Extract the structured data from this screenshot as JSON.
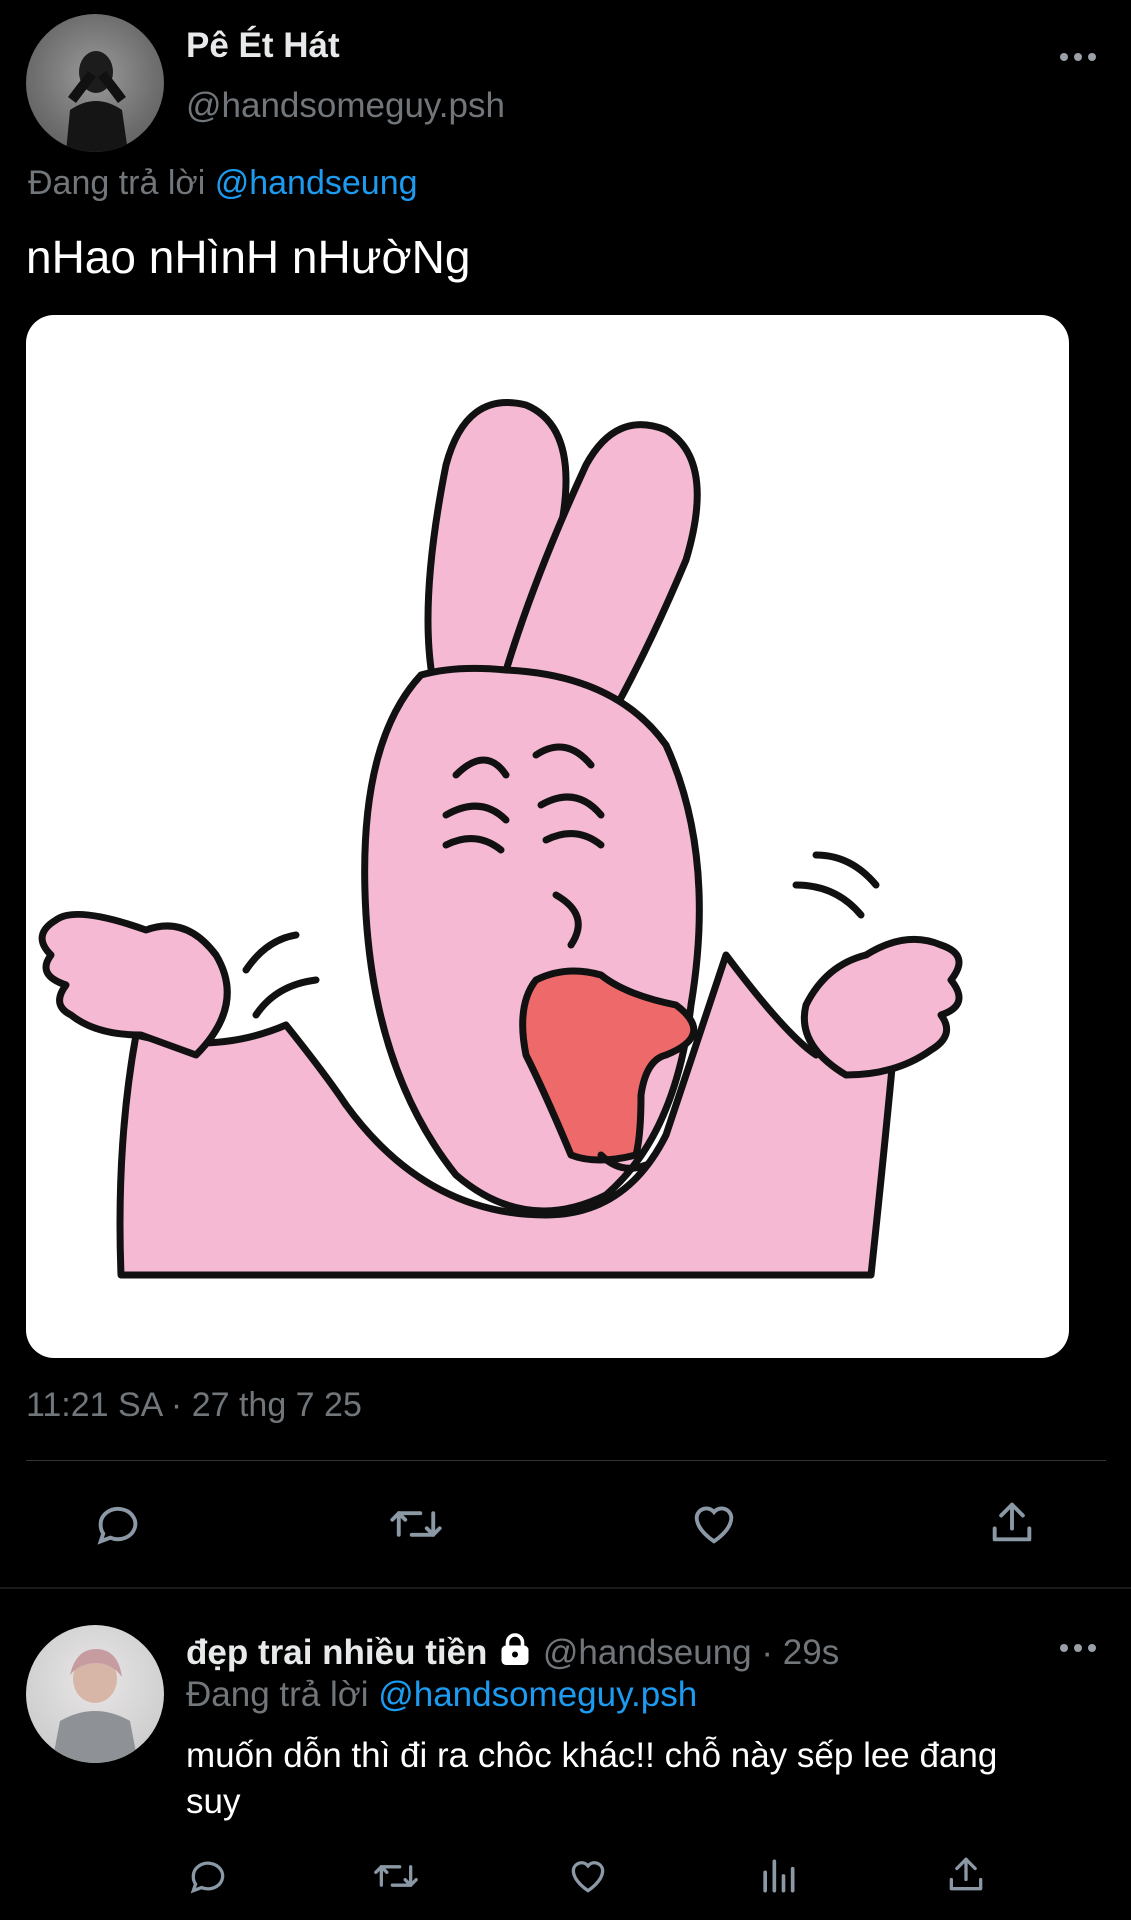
{
  "tweet": {
    "author_name": "Pê Ét Hát",
    "author_handle": "@handsomeguy.psh",
    "reply_prefix": "Đang trả lời",
    "reply_to": "@handseung",
    "text": "nHao nHìnH nHườNg",
    "timestamp": "11:21 SA · 27 thg 7 25",
    "media": "pink-rabbit-shrug-sticker",
    "more_icon": "more-horizontal-icon"
  },
  "reply": {
    "author_name": "đẹp trai nhiều tiền",
    "lock_icon": "lock-icon",
    "author_handle": "@handseung",
    "separator": "·",
    "time": "29s",
    "reply_prefix": "Đang trả lời",
    "reply_to": "@handsomeguy.psh",
    "text": "muốn dỗn thì đi ra chôc khác!! chỗ này sếp lee đang suy"
  },
  "colors": {
    "background": "#000000",
    "text": "#e7e9ea",
    "muted": "#71767b",
    "link": "#1d9bf0",
    "rabbit_pink": "#f6b9d3",
    "mouth_red": "#ee6a6a"
  }
}
